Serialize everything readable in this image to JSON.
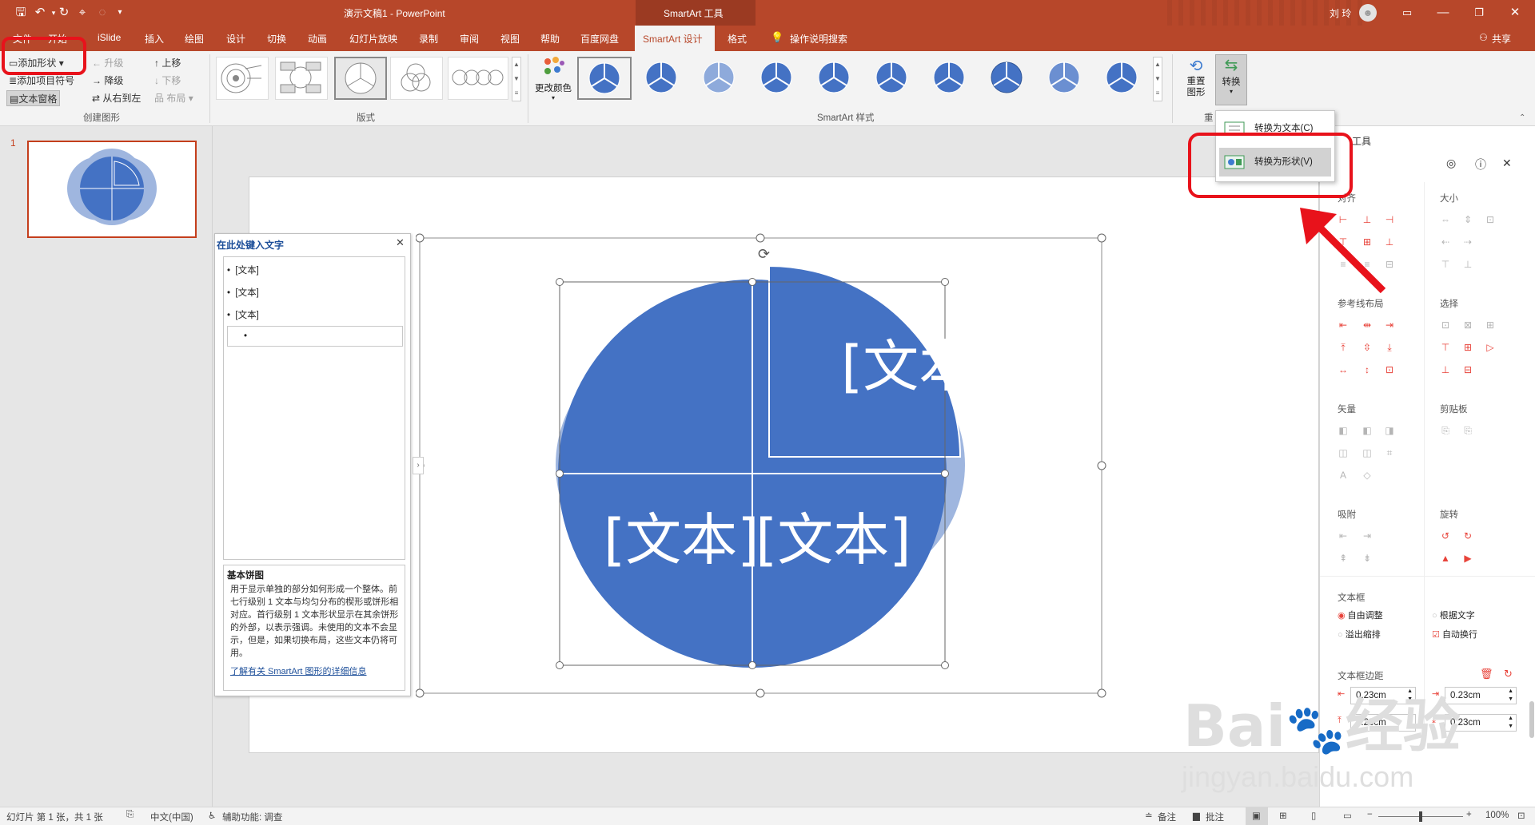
{
  "titlebar": {
    "doc_title": "演示文稿1  -  PowerPoint",
    "context_tab": "SmartArt 工具",
    "user": "刘 玲"
  },
  "tabs": [
    "文件",
    "开始",
    "iSlide",
    "插入",
    "绘图",
    "设计",
    "切换",
    "动画",
    "幻灯片放映",
    "录制",
    "审阅",
    "视图",
    "帮助",
    "百度网盘",
    "SmartArt 设计",
    "格式"
  ],
  "tell_me": "操作说明搜索",
  "share": "共享",
  "create_group": {
    "add_shape": "添加形状",
    "add_bullet": "添加项目符号",
    "text_pane": "文本窗格",
    "promote": "升级",
    "demote": "降级",
    "rtl": "从右到左",
    "move_up": "上移",
    "move_down": "下移",
    "layout": "布局",
    "label": "创建图形"
  },
  "layouts_label": "版式",
  "styles_label": "SmartArt 样式",
  "change_color": "更改颜色",
  "reset_group": {
    "reset": "重置图形",
    "convert": "转换",
    "label": "重"
  },
  "convert_menu": {
    "to_text": "转换为文本(C)",
    "to_shape": "转换为形状(V)"
  },
  "slide_number": "1",
  "text_pane": {
    "title": "在此处键入文字",
    "items": [
      "[文本]",
      "[文本]",
      "[文本]",
      ""
    ],
    "desc_title": "基本饼图",
    "desc": "用于显示单独的部分如何形成一个整体。前七行级别 1 文本与均匀分布的楔形或饼形相对应。首行级别 1 文本形状显示在其余饼形的外部，以表示强调。未使用的文本不会显示，但是，如果切换布局，这些文本仍将可用。",
    "link": "了解有关 SmartArt 图形的详细信息"
  },
  "smartart": {
    "labels": [
      "[文本]",
      "[文本]",
      "[文本]"
    ],
    "fill": "#4472c4",
    "light": "#9fb6df"
  },
  "right_panel": {
    "title": "工具",
    "align": "对齐",
    "size": "大小",
    "guides": "参考线布局",
    "select": "选择",
    "vector": "矢量",
    "clipboard": "剪贴板",
    "snap": "吸附",
    "rotate": "旋转",
    "textbox": "文本框",
    "free_adjust": "自由调整",
    "fit_text": "根据文字",
    "overflow": "溢出缩排",
    "auto_wrap": "自动换行",
    "margins": "文本框边距",
    "m_left": "0.23cm",
    "m_right": "0.23cm",
    "m_top": "0.23cm",
    "m_bottom": "0.23cm"
  },
  "status": {
    "slide_info": "幻灯片 第 1 张，共 1 张",
    "language": "中文(中国)",
    "accessibility": "辅助功能: 调查",
    "notes": "备注",
    "comments": "批注",
    "zoom": "100%"
  },
  "watermark": {
    "brand": "Bai",
    "brand2": "经验",
    "url": "jingyan.baidu.com"
  },
  "colors": {
    "ribbon_red": "#b7472a",
    "highlight": "#e8121b",
    "accent_blue": "#4472c4"
  }
}
